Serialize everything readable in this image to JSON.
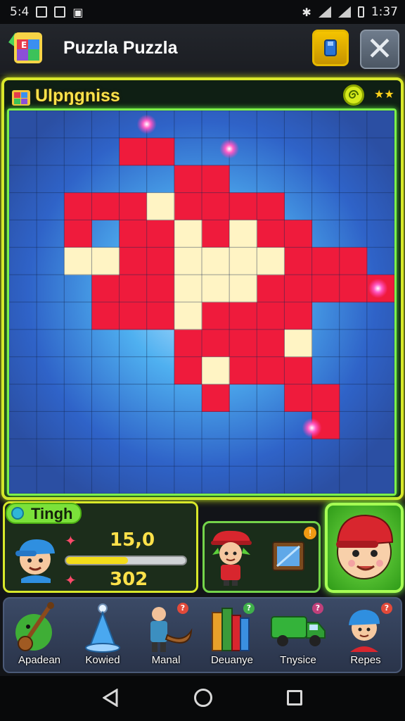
{
  "status_bar": {
    "time_left": "5:4",
    "time_right": "1:37"
  },
  "header": {
    "title": "Puzzla Puzzla"
  },
  "board": {
    "title": "Ulpŋgniss",
    "stars": "★★",
    "cols": 14,
    "rows": 14,
    "red_cells": [
      [
        4,
        1
      ],
      [
        5,
        1
      ],
      [
        6,
        2
      ],
      [
        7,
        2
      ],
      [
        2,
        3
      ],
      [
        3,
        3
      ],
      [
        4,
        3
      ],
      [
        5,
        3
      ],
      [
        6,
        3
      ],
      [
        7,
        3
      ],
      [
        8,
        3
      ],
      [
        9,
        3
      ],
      [
        2,
        4
      ],
      [
        4,
        4
      ],
      [
        5,
        4
      ],
      [
        7,
        4
      ],
      [
        8,
        4
      ],
      [
        9,
        4
      ],
      [
        10,
        4
      ],
      [
        4,
        5
      ],
      [
        5,
        5
      ],
      [
        10,
        5
      ],
      [
        11,
        5
      ],
      [
        12,
        5
      ],
      [
        3,
        6
      ],
      [
        4,
        6
      ],
      [
        5,
        6
      ],
      [
        6,
        6
      ],
      [
        7,
        6
      ],
      [
        8,
        6
      ],
      [
        9,
        6
      ],
      [
        10,
        6
      ],
      [
        11,
        6
      ],
      [
        12,
        6
      ],
      [
        13,
        6
      ],
      [
        3,
        7
      ],
      [
        4,
        7
      ],
      [
        5,
        7
      ],
      [
        6,
        7
      ],
      [
        7,
        7
      ],
      [
        8,
        7
      ],
      [
        9,
        7
      ],
      [
        10,
        7
      ],
      [
        6,
        8
      ],
      [
        7,
        8
      ],
      [
        8,
        8
      ],
      [
        9,
        8
      ],
      [
        6,
        9
      ],
      [
        8,
        9
      ],
      [
        9,
        9
      ],
      [
        10,
        9
      ],
      [
        7,
        10
      ],
      [
        10,
        10
      ],
      [
        11,
        10
      ],
      [
        11,
        11
      ]
    ],
    "light_cells": [
      [
        5,
        3
      ],
      [
        2,
        5
      ],
      [
        3,
        5
      ],
      [
        6,
        4
      ],
      [
        6,
        5
      ],
      [
        7,
        5
      ],
      [
        8,
        5
      ],
      [
        9,
        5
      ],
      [
        6,
        6
      ],
      [
        7,
        6
      ],
      [
        8,
        6
      ],
      [
        6,
        7
      ],
      [
        10,
        8
      ],
      [
        7,
        9
      ],
      [
        8,
        4
      ]
    ],
    "glow_points": [
      [
        5,
        0.5
      ],
      [
        8,
        1.4
      ],
      [
        13.4,
        6.5
      ],
      [
        11,
        11.6
      ]
    ]
  },
  "player": {
    "name": "Tingh",
    "score_top": "15,0",
    "score_bottom": "302",
    "progress": 0.52
  },
  "mid_badge": "!",
  "toolbar": {
    "items": [
      {
        "label": "Apadean",
        "badge": ""
      },
      {
        "label": "Kowied",
        "badge": ""
      },
      {
        "label": "Manal",
        "badge": "?"
      },
      {
        "label": "Deuanye",
        "badge": "?"
      },
      {
        "label": "Tnysice",
        "badge": "?"
      },
      {
        "label": "Repes",
        "badge": "?"
      }
    ]
  }
}
